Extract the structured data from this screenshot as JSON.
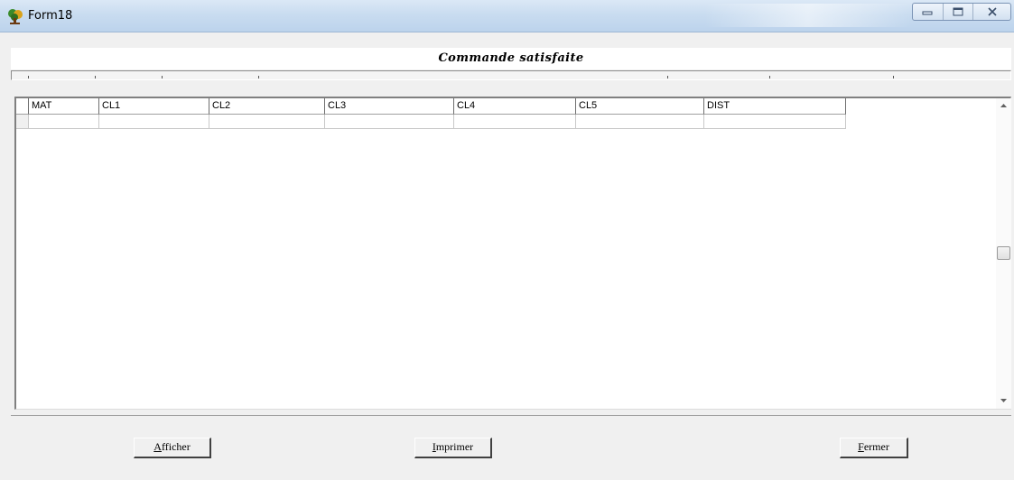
{
  "window": {
    "title": "Form18"
  },
  "caption": "Commande satisfaite",
  "grid": {
    "columns": [
      "MAT",
      "CL1",
      "CL2",
      "CL3",
      "CL4",
      "CL5",
      "DIST"
    ],
    "rows": [
      [
        "",
        "",
        "",
        "",
        "",
        "",
        ""
      ]
    ]
  },
  "buttons": {
    "afficher": {
      "mnemonic": "A",
      "rest": "fficher"
    },
    "imprimer": {
      "mnemonic": "I",
      "rest": "mprimer"
    },
    "fermer": {
      "mnemonic": "F",
      "rest": "ermer"
    }
  },
  "icons": {
    "app": "app-tree-icon",
    "minimize": "minimize-icon",
    "maximize": "maximize-icon",
    "close": "close-icon",
    "scroll_up": "arrow-up-icon",
    "scroll_down": "arrow-down-icon"
  },
  "colors": {
    "titlebar": "#c9dcf0",
    "window": "#f0f0f0",
    "grid_background": "#ffffff"
  }
}
